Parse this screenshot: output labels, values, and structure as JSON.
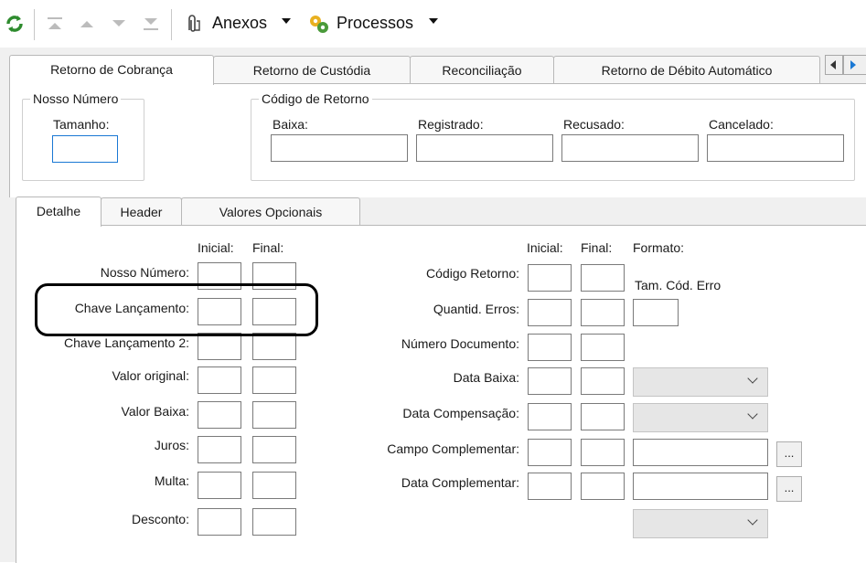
{
  "toolbar": {
    "anexos_label": "Anexos",
    "processos_label": "Processos",
    "icons": [
      "refresh-icon",
      "first-icon",
      "previous-icon",
      "next-icon",
      "last-icon",
      "paperclip-icon",
      "gears-icon"
    ]
  },
  "top_tabs": [
    "Retorno de Cobrança",
    "Retorno de Custódia",
    "Reconciliação",
    "Retorno de Débito Automático"
  ],
  "nosso_numero_group": {
    "legend": "Nosso Número",
    "tamanho_label": "Tamanho:"
  },
  "codigo_retorno_group": {
    "legend": "Código de Retorno",
    "fields": [
      "Baixa:",
      "Registrado:",
      "Recusado:",
      "Cancelado:"
    ]
  },
  "inner_tabs": [
    "Detalhe",
    "Header",
    "Valores Opcionais"
  ],
  "left_columns": {
    "inicial": "Inicial:",
    "final": "Final:"
  },
  "left_rows": [
    "Nosso Número:",
    "Chave Lançamento:",
    "Chave Lançamento 2:",
    "Valor original:",
    "Valor Baixa:",
    "Juros:",
    "Multa:",
    "Desconto:"
  ],
  "right_columns": {
    "inicial": "Inicial:",
    "final": "Final:",
    "formato": "Formato:"
  },
  "right_rows": [
    "Código Retorno:",
    "Quantid. Erros:",
    "Número Documento:",
    "Data Baixa:",
    "Data Compensação:",
    "Campo Complementar:",
    "Data Complementar:"
  ],
  "tam_cod_erro_label": "Tam. Cód. Erro",
  "ellipsis": "...",
  "colors": {
    "focus_border": "#1a78d4",
    "panel_bg": "#f0f0f0"
  }
}
